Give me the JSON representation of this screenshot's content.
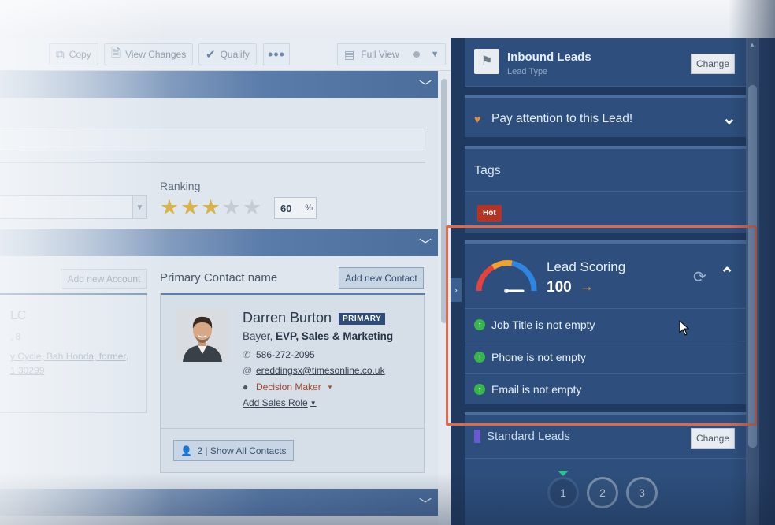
{
  "toolbar": {
    "copy_label": "Copy",
    "view_changes_label": "View Changes",
    "qualify_label": "Qualify",
    "more_label": "•••",
    "view_select_label": "Full View"
  },
  "details": {
    "ranking_label": "Ranking",
    "ranking_value": "60",
    "ranking_unit": "%",
    "stars_total": 5,
    "stars_filled": 3
  },
  "account": {
    "add_button": "Add new Account",
    "name_partial": "LC",
    "line2_partial": ", 8",
    "line3_partial": "y Cycle, Bah Honda, former,",
    "line4_partial": "1 30299"
  },
  "contact": {
    "section_title": "Primary Contact name",
    "add_button": "Add new Contact",
    "name": "Darren Burton",
    "badge": "PRIMARY",
    "role_company": "Bayer,",
    "role_title": "EVP, Sales & Marketing",
    "phone": "586-272-2095",
    "email": "ereddingsx@timesonline.co.uk",
    "decision_role": "Decision Maker",
    "add_sales_role": "Add Sales Role",
    "show_all": "2 | Show All Contacts"
  },
  "right_panel": {
    "lead_type": {
      "title": "Inbound Leads",
      "subtitle": "Lead Type",
      "change_label": "Change"
    },
    "attention": {
      "text": "Pay attention to this Lead!"
    },
    "tags": {
      "title": "Tags",
      "items": [
        "Hot"
      ]
    },
    "lead_scoring": {
      "title": "Lead Scoring",
      "score": "100",
      "rules": [
        "Job Title is not empty",
        "Phone is not empty",
        "Email is not empty"
      ]
    },
    "pipeline": {
      "title": "Standard Leads",
      "change_label": "Change",
      "steps": [
        "1",
        "2",
        "3"
      ]
    }
  },
  "colors": {
    "highlight": "#e2684a",
    "hot_tag": "#b63322",
    "rule_ok": "#38b64c",
    "score_arrow": "#f29b38"
  }
}
